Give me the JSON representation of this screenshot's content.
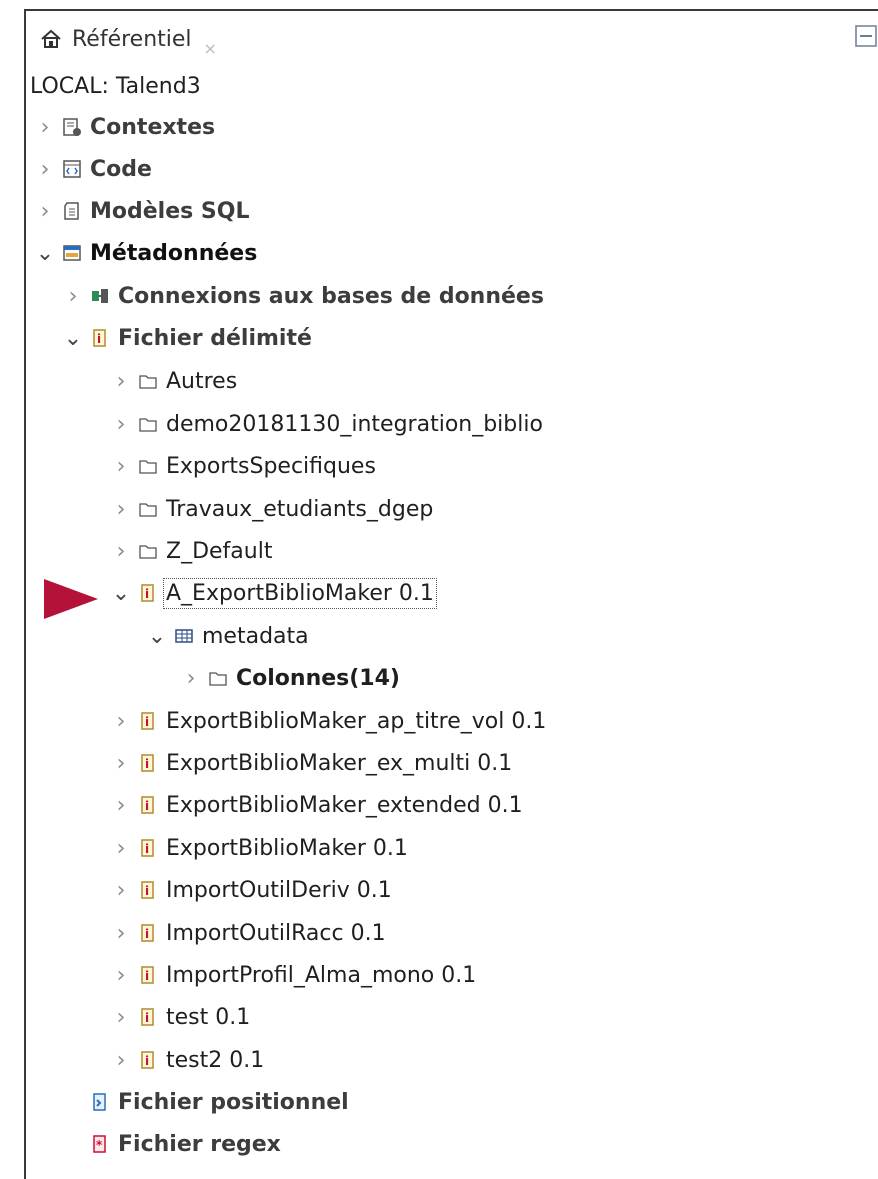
{
  "tab": {
    "title": "Référentiel",
    "close": "×"
  },
  "project": "LOCAL: Talend3",
  "tree": {
    "contextes": "Contextes",
    "code": "Code",
    "modeles_sql": "Modèles SQL",
    "metadonnees": "Métadonnées",
    "connexions": "Connexions aux bases de données",
    "fichier_delimite": "Fichier délimité",
    "folders": [
      "Autres",
      "demo20181130_integration_biblio",
      "ExportsSpecifiques",
      "Travaux_etudiants_dgep",
      "Z_Default"
    ],
    "selected_item": "A_ExportBiblioMaker 0.1",
    "metadata": "metadata",
    "colonnes": "Colonnes(14)",
    "files": [
      "ExportBiblioMaker_ap_titre_vol 0.1",
      "ExportBiblioMaker_ex_multi 0.1",
      "ExportBiblioMaker_extended 0.1",
      "ExportBiblioMaker 0.1",
      "ImportOutilDeriv 0.1",
      "ImportOutilRacc 0.1",
      "ImportProfil_Alma_mono 0.1",
      "test 0.1",
      "test2 0.1"
    ],
    "fichier_positionnel": "Fichier positionnel",
    "fichier_regex": "Fichier regex"
  },
  "colors": {
    "pointer": "#b5123a",
    "file_icon": "#c8102e",
    "folder_icon": "#555555"
  }
}
